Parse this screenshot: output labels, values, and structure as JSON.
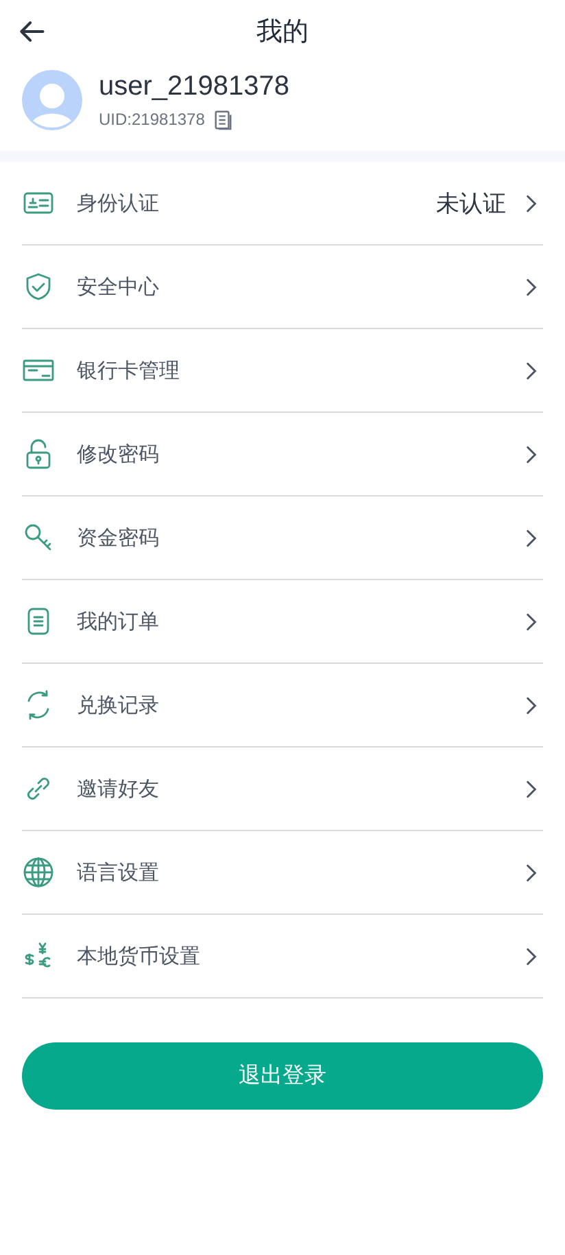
{
  "header": {
    "title": "我的"
  },
  "profile": {
    "username": "user_21981378",
    "uid": "UID:21981378"
  },
  "menu": [
    {
      "kind": "id-card",
      "label": "身份认证",
      "value": "未认证"
    },
    {
      "kind": "shield",
      "label": "安全中心"
    },
    {
      "kind": "card",
      "label": "银行卡管理"
    },
    {
      "kind": "lock",
      "label": "修改密码"
    },
    {
      "kind": "key",
      "label": "资金密码"
    },
    {
      "kind": "list",
      "label": "我的订单"
    },
    {
      "kind": "refresh",
      "label": "兑换记录"
    },
    {
      "kind": "link",
      "label": "邀请好友"
    },
    {
      "kind": "globe",
      "label": "语言设置"
    },
    {
      "kind": "currency",
      "label": "本地货币设置"
    }
  ],
  "logout_button": "退出登录"
}
